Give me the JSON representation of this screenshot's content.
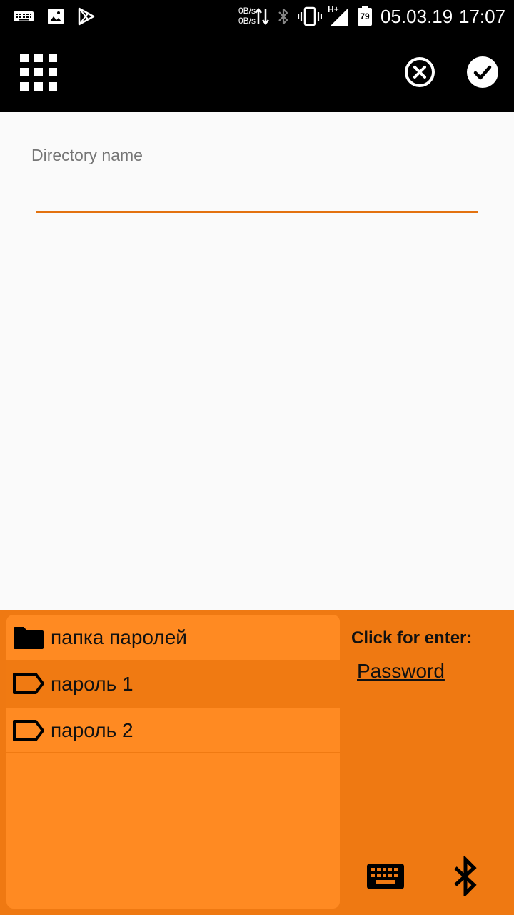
{
  "status_bar": {
    "net_up": "0B/s",
    "net_down": "0B/s",
    "network_type": "H+",
    "battery": "79",
    "date": "05.03.19",
    "time": "17:07"
  },
  "app_bar": {
    "menu_icon": "grid-icon",
    "cancel_icon": "cancel-circle-icon",
    "confirm_icon": "checkmark-icon"
  },
  "form": {
    "field_label": "Directory name",
    "field_value": ""
  },
  "panel": {
    "items": [
      {
        "label": "папка паролей",
        "icon": "folder-icon"
      },
      {
        "label": "пароль 1",
        "icon": "tag-icon"
      },
      {
        "label": "пароль 2",
        "icon": "tag-icon"
      }
    ],
    "click_label": "Click for enter:",
    "password_link": "Password",
    "keyboard_icon": "keyboard-icon",
    "bluetooth_icon": "bluetooth-icon"
  },
  "colors": {
    "accent": "#e3720f",
    "panel_bg": "#ef7912",
    "list_bg": "#ff8a22",
    "bar_bg": "#000000"
  }
}
